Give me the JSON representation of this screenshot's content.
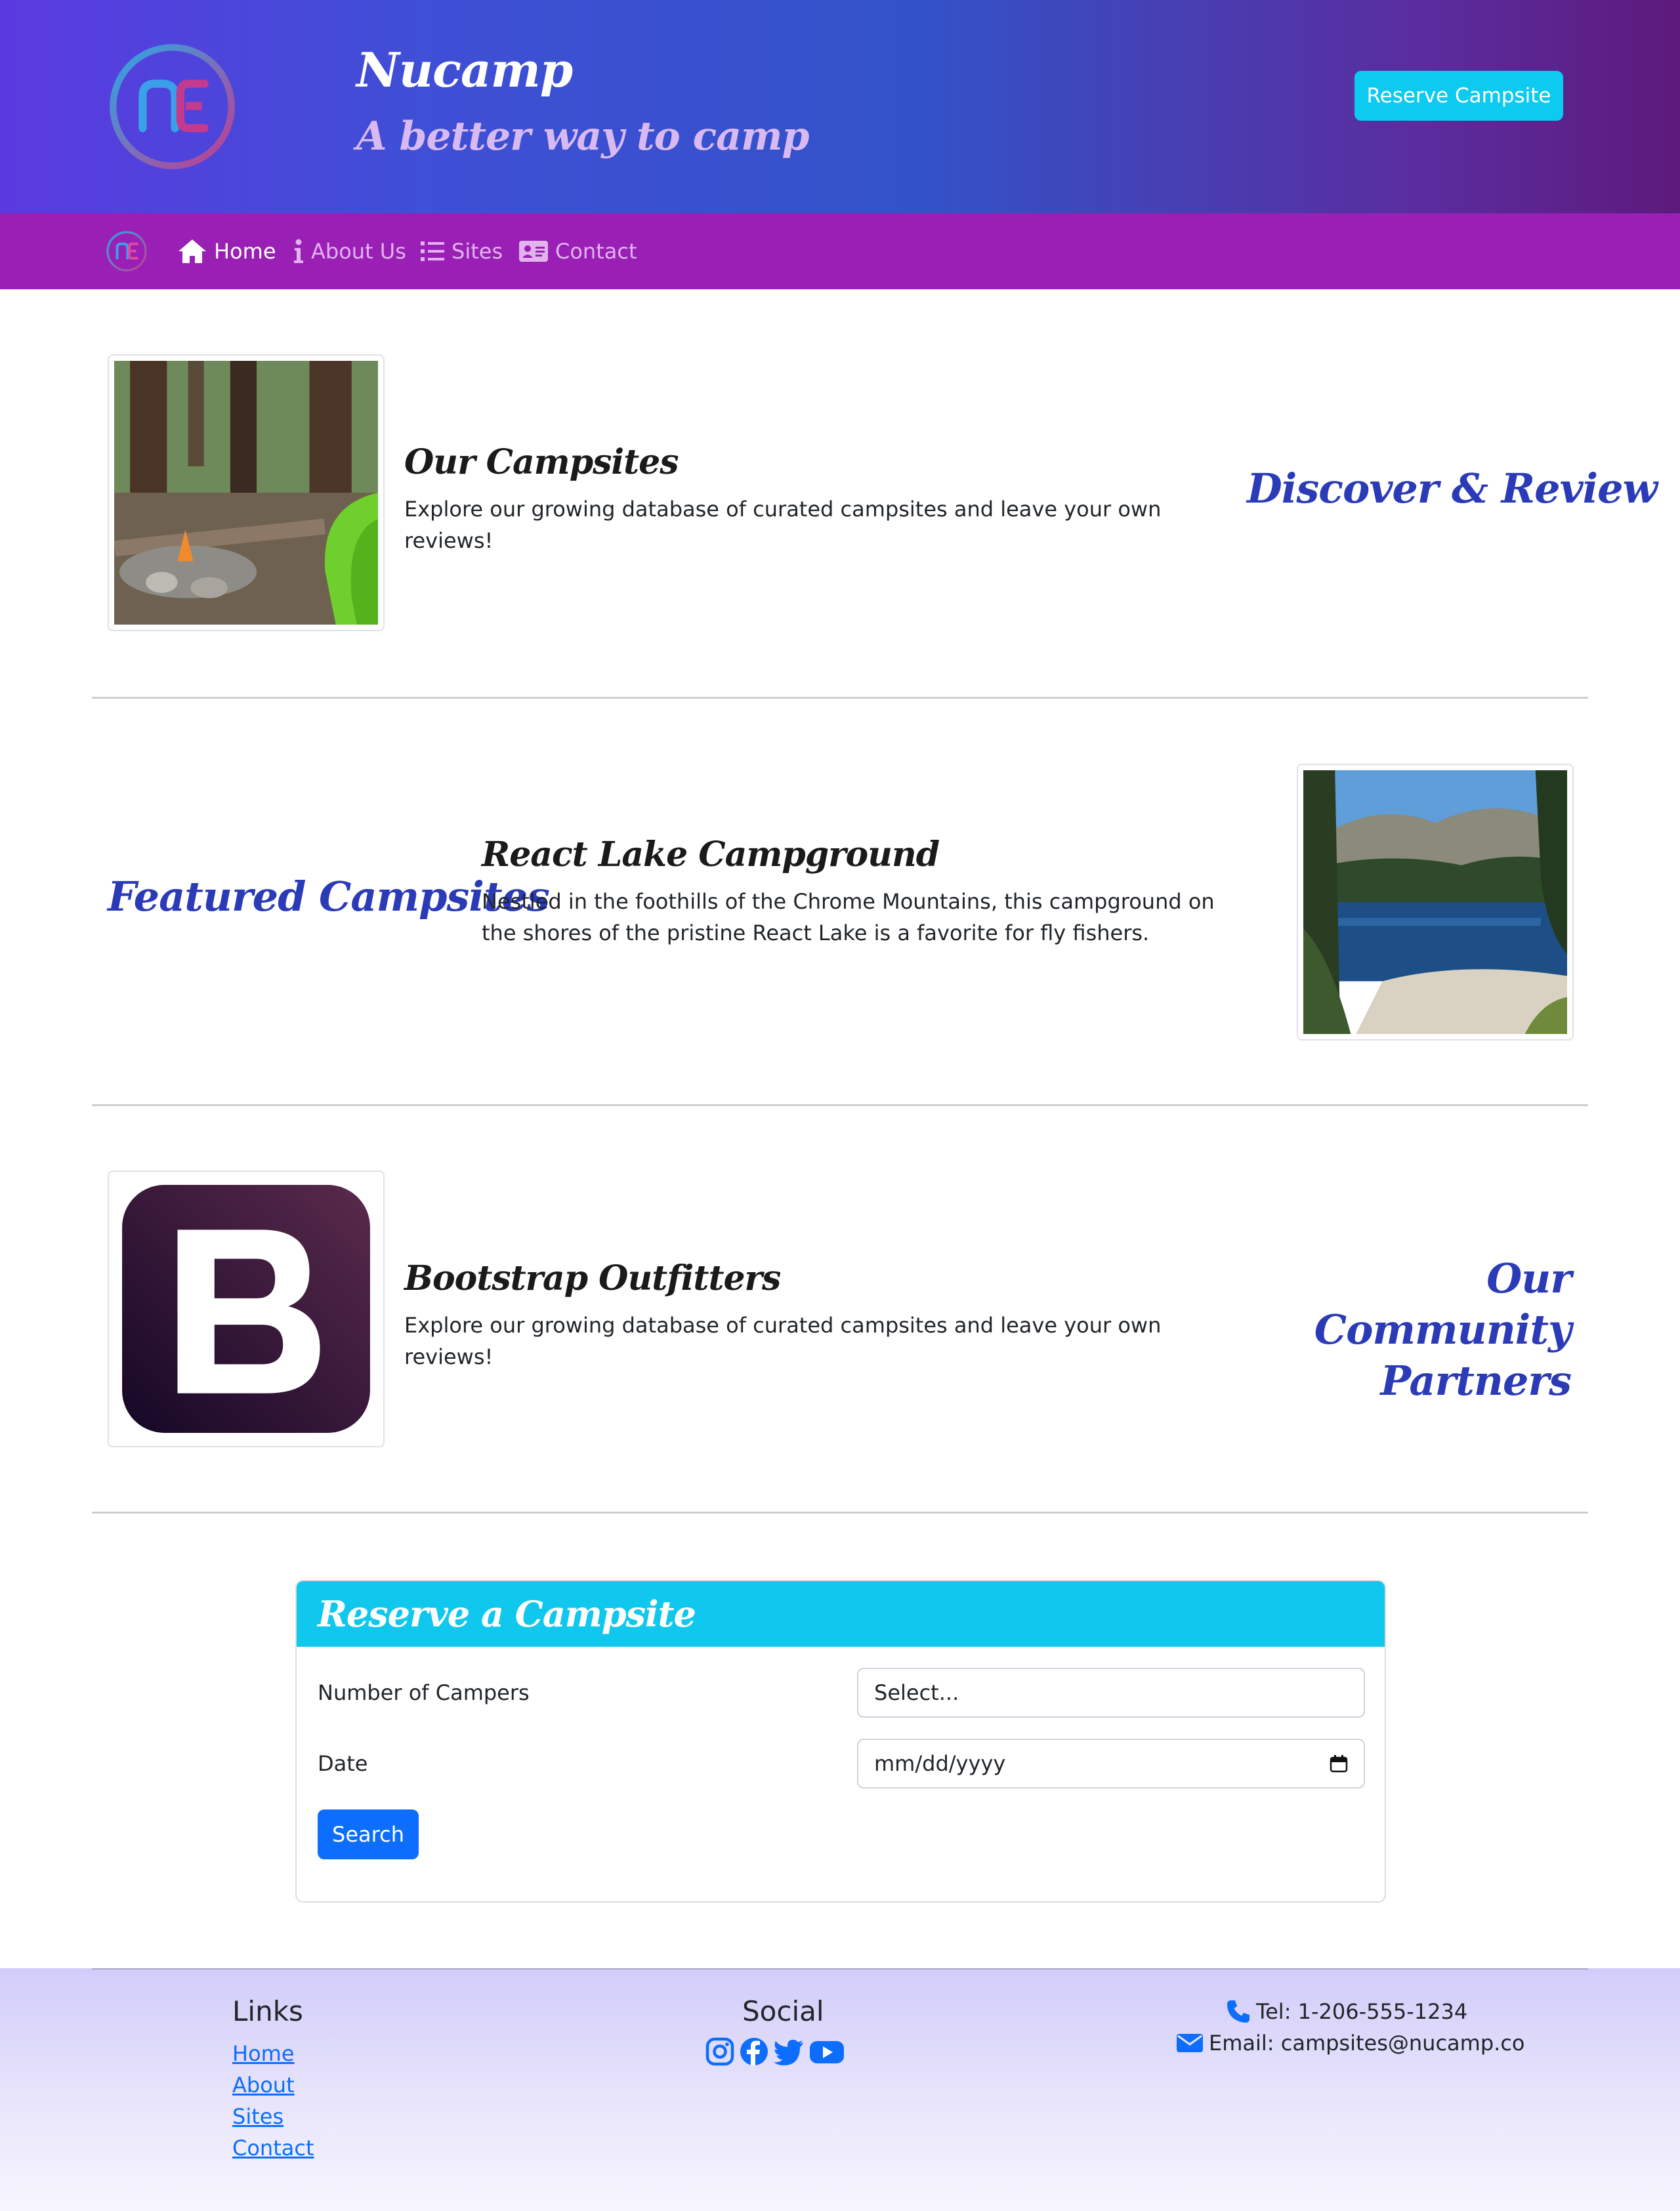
{
  "header": {
    "brand": "Nucamp",
    "tagline": "A better way to camp",
    "reserve_button": "Reserve Campsite"
  },
  "nav": {
    "items": [
      {
        "label": "Home",
        "icon": "home-icon",
        "active": true
      },
      {
        "label": "About Us",
        "icon": "info-icon",
        "active": false
      },
      {
        "label": "Sites",
        "icon": "list-icon",
        "active": false
      },
      {
        "label": "Contact",
        "icon": "address-card-icon",
        "active": false
      }
    ]
  },
  "sections": [
    {
      "title": "Our Campsites",
      "text": "Explore our growing database of curated campsites and leave your own reviews!",
      "side_heading": "Discover & Review"
    },
    {
      "title": "React Lake Campground",
      "text": "Nestled in the foothills of the Chrome Mountains, this campground on the shores of the pristine React Lake is a favorite for fly fishers.",
      "side_heading": "Featured Campsites"
    },
    {
      "title": "Bootstrap Outfitters",
      "text": "Explore our growing database of curated campsites and leave your own reviews!",
      "side_heading": "Our Community Partners"
    }
  ],
  "reserve_form": {
    "title": "Reserve a Campsite",
    "campers_label": "Number of Campers",
    "campers_value": "Select...",
    "date_label": "Date",
    "date_value": "mm/dd/yyyy",
    "search_button": "Search"
  },
  "footer": {
    "links_heading": "Links",
    "links": [
      "Home",
      "About",
      "Sites",
      "Contact"
    ],
    "social_heading": "Social",
    "social_icons": [
      "instagram-icon",
      "facebook-icon",
      "twitter-icon",
      "youtube-icon"
    ],
    "tel": "Tel: 1-206-555-1234",
    "email": "Email: campsites@nucamp.co"
  },
  "colors": {
    "brand_blue": "#2b3bb8",
    "navbar": "#9a1fb5",
    "info": "#0dcaf0",
    "primary": "#0d6efd"
  }
}
